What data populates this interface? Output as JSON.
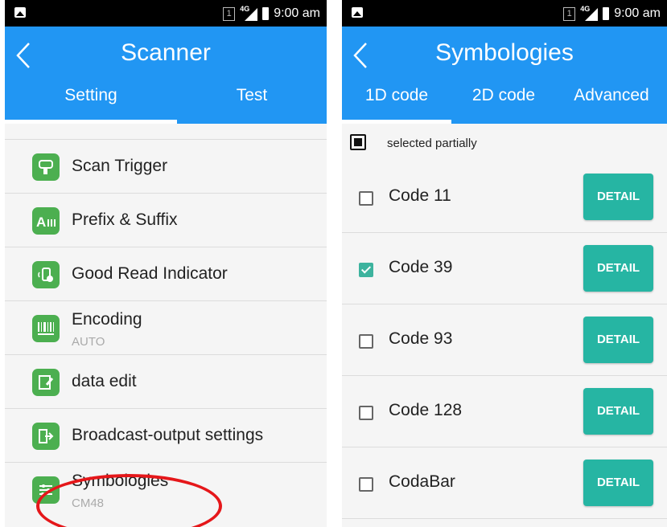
{
  "left": {
    "status": {
      "sim": "1",
      "network": "4G",
      "time": "9:00 am"
    },
    "title": "Scanner",
    "tabs": [
      {
        "label": "Setting",
        "active": true
      },
      {
        "label": "Test",
        "active": false
      }
    ],
    "items": [
      {
        "label": "Scan Trigger",
        "icon": "scan-trigger-icon"
      },
      {
        "label": "Prefix & Suffix",
        "icon": "prefix-suffix-icon"
      },
      {
        "label": "Good Read Indicator",
        "icon": "good-read-indicator-icon"
      },
      {
        "label": "Encoding",
        "sub": "AUTO",
        "icon": "barcode-encoding-icon"
      },
      {
        "label": "data edit",
        "icon": "data-edit-icon"
      },
      {
        "label": "Broadcast-output settings",
        "icon": "broadcast-output-icon"
      },
      {
        "label": "Symbologies",
        "sub": "CM48",
        "icon": "symbologies-icon"
      }
    ]
  },
  "right": {
    "status": {
      "sim": "1",
      "network": "4G",
      "time": "9:00 am"
    },
    "title": "Symbologies",
    "tabs": [
      {
        "label": "1D code",
        "active": true
      },
      {
        "label": "2D code",
        "active": false
      },
      {
        "label": "Advanced",
        "active": false
      }
    ],
    "selected_partially_label": "selected partially",
    "codes": [
      {
        "name": "Code 11",
        "checked": false,
        "detail": "DETAIL"
      },
      {
        "name": "Code 39",
        "checked": true,
        "detail": "DETAIL"
      },
      {
        "name": "Code 93",
        "checked": false,
        "detail": "DETAIL"
      },
      {
        "name": "Code 128",
        "checked": false,
        "detail": "DETAIL"
      },
      {
        "name": "CodaBar",
        "checked": false,
        "detail": "DETAIL"
      }
    ]
  },
  "colors": {
    "appbar": "#2196f3",
    "icon_green": "#4caf50",
    "detail_button": "#26b5a3",
    "checkbox_checked": "#3db39e",
    "highlight_ellipse": "#e5171a"
  }
}
